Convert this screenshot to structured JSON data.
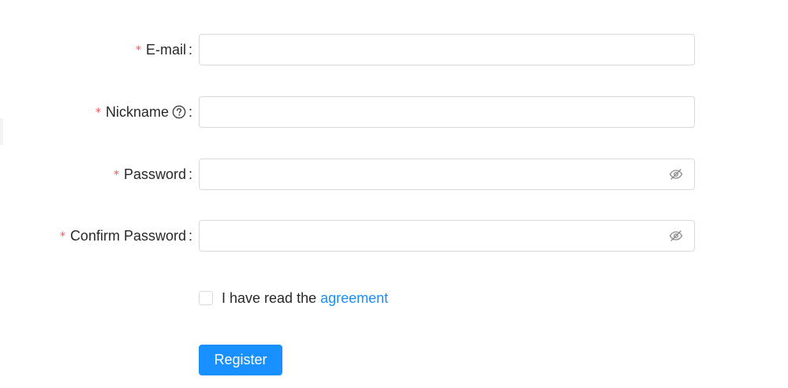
{
  "form": {
    "email": {
      "required_mark": "*",
      "label": "E-mail",
      "colon": ":",
      "value": "",
      "placeholder": ""
    },
    "nickname": {
      "required_mark": "*",
      "label": "Nickname",
      "colon": ":",
      "help_icon": "question-circle-icon",
      "value": "",
      "placeholder": ""
    },
    "password": {
      "required_mark": "*",
      "label": "Password",
      "colon": ":",
      "value": "",
      "placeholder": "",
      "toggle_icon": "eye-invisible-icon"
    },
    "confirm_password": {
      "required_mark": "*",
      "label": "Confirm Password",
      "colon": ":",
      "value": "",
      "placeholder": "",
      "toggle_icon": "eye-invisible-icon"
    },
    "agreement": {
      "checked": false,
      "text": "I have read the",
      "link_text": "agreement"
    },
    "submit_label": "Register"
  },
  "colors": {
    "primary": "#1890ff",
    "required": "#ff4d4f",
    "border": "#d9d9d9",
    "text": "#262626",
    "icon": "#8c8c8c"
  }
}
